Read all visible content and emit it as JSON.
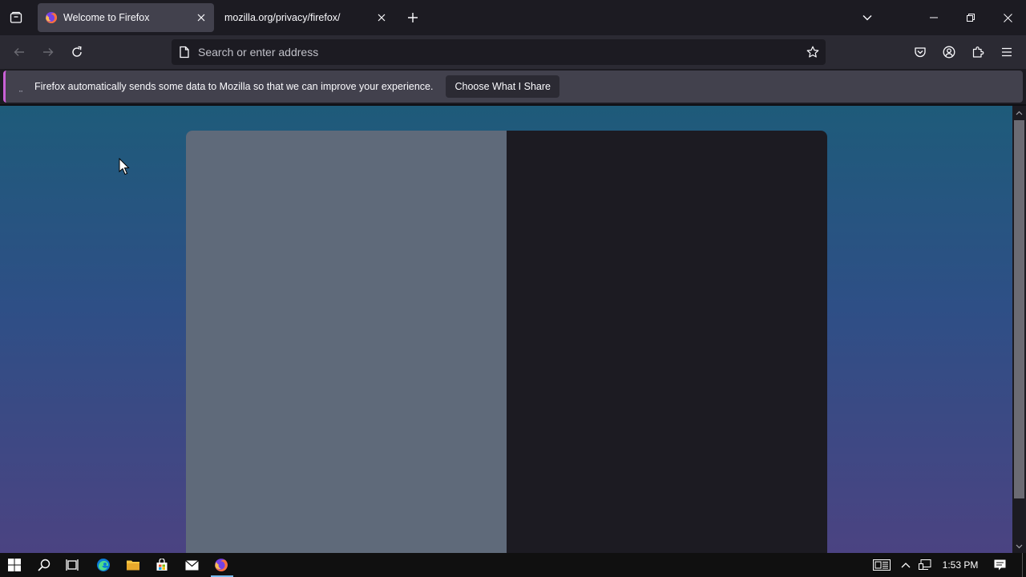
{
  "tabs": [
    {
      "title": "Welcome to Firefox",
      "active": true,
      "icon": "firefox-icon"
    },
    {
      "title": "mozilla.org/privacy/firefox/",
      "active": false,
      "icon": ""
    }
  ],
  "urlbar": {
    "placeholder": "Search or enter address",
    "value": ""
  },
  "notification": {
    "text": "Firefox automatically sends some data to Mozilla so that we can improve your experience.",
    "button_label": "Choose What I Share",
    "accent_color": "#c961d6"
  },
  "taskbar": {
    "clock": "1:53 PM",
    "apps": [
      "windows-start-icon",
      "search-icon",
      "task-view-icon",
      "edge-icon",
      "file-explorer-icon",
      "store-icon",
      "mail-icon",
      "firefox-icon"
    ]
  },
  "colors": {
    "chrome_dark": "#1c1b22",
    "toolbar": "#2b2a33",
    "tab_active": "#42414d",
    "content_gradient_top": "#1e5b7a",
    "content_gradient_bottom": "#4b4382",
    "modal_left": "#5f6a7a",
    "modal_right": "#1c1b22"
  }
}
